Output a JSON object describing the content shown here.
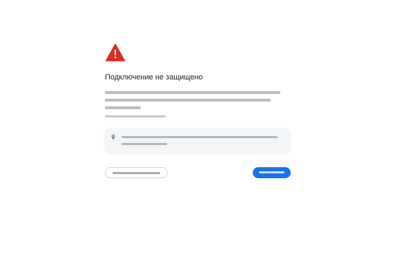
{
  "interstitial": {
    "title": "Подключение не защищено"
  },
  "colors": {
    "warning": "#d93025",
    "primary_button": "#1a73e8",
    "text": "#202124"
  },
  "icons": {
    "warning": "warning-triangle-icon",
    "location": "location-pin-icon"
  }
}
